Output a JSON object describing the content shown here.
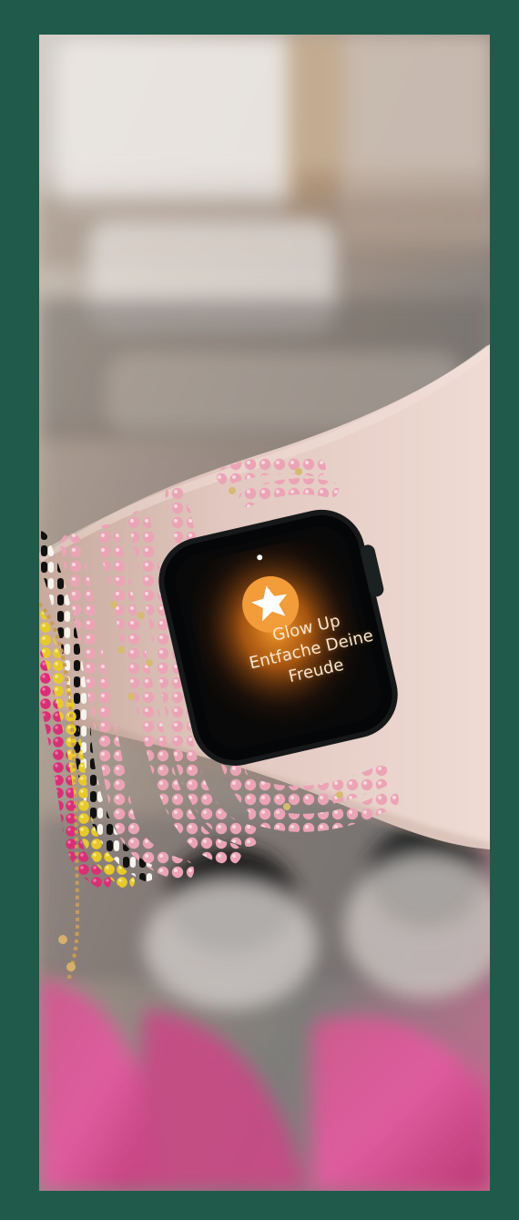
{
  "colors": {
    "frame": "#1f5a4b",
    "watch_glow": "#ff9f2d",
    "star_badge": "#f29c3a",
    "text": "#fbe7d1",
    "pink_beads": "#e9a8b5",
    "magenta_beads": "#d92f75",
    "yellow_beads": "#e7c92b",
    "black_white_beads": "#111111"
  },
  "watch_notification": {
    "icon": "star-icon",
    "title": "Glow Up",
    "message_line_1": "Entfache Deine",
    "message_line_2": "Freude"
  }
}
